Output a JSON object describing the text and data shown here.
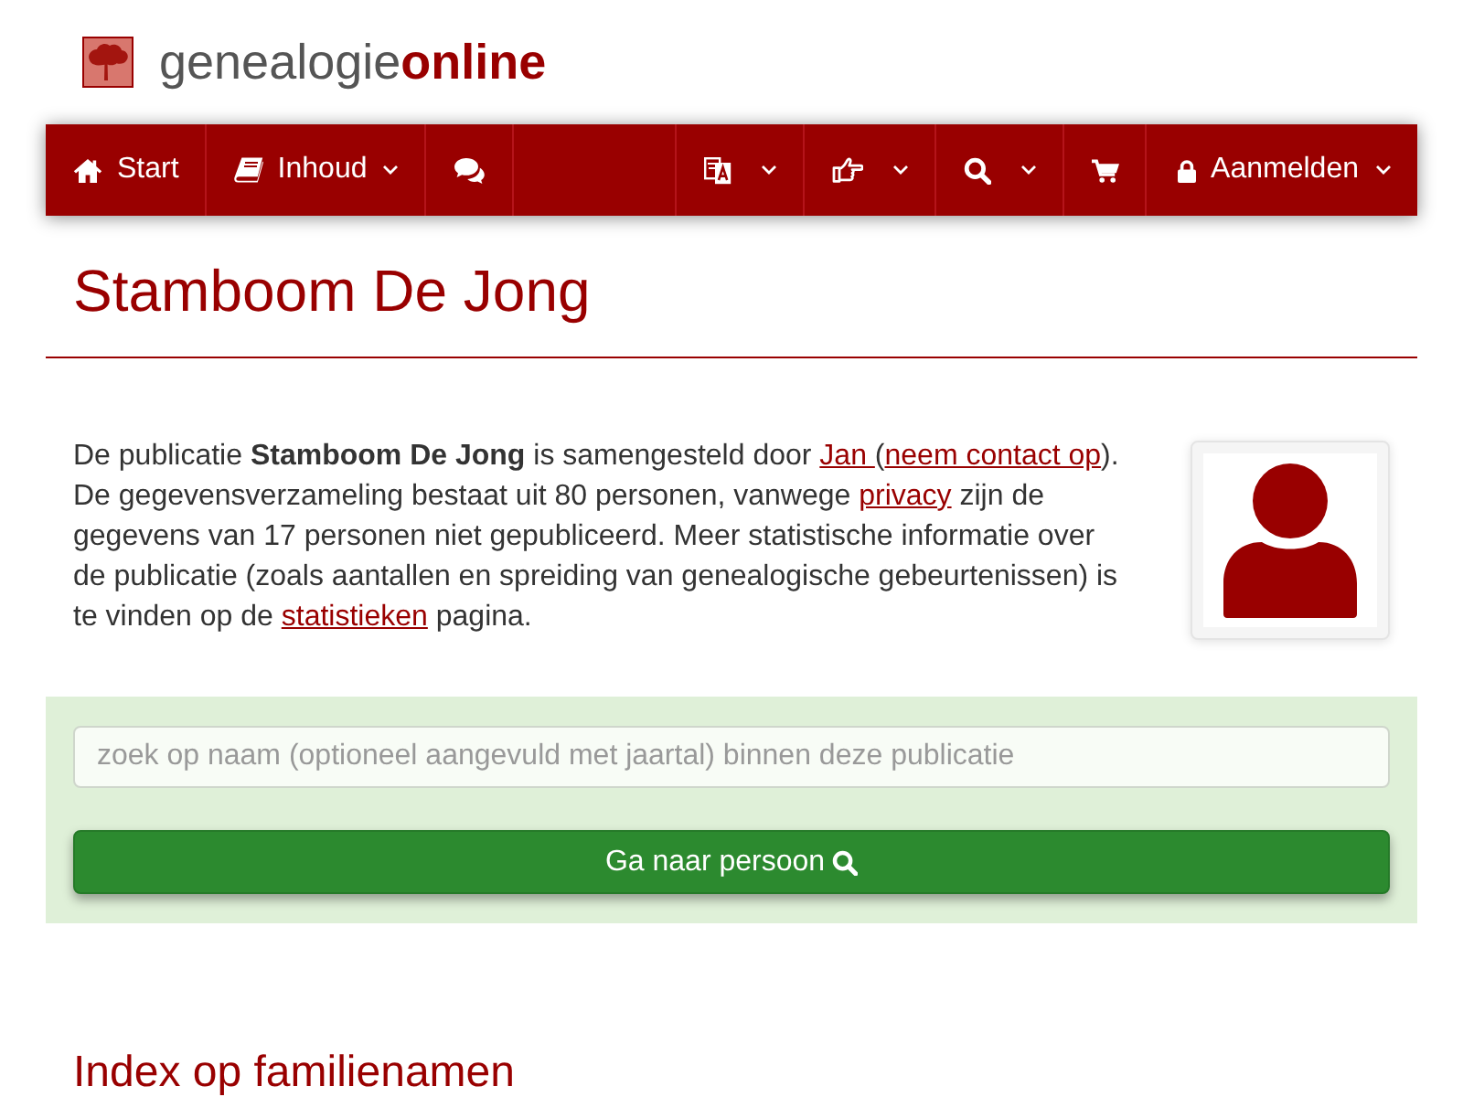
{
  "header": {
    "logo": "genealogie**online**"
  },
  "nav": {
    "left": [
      {
        "kind": "home",
        "label": "Start",
        "menu": false
      },
      {
        "kind": "contents",
        "label": "Inhoud",
        "menu": true
      },
      {
        "kind": "forum",
        "menu": false
      }
    ],
    "right": [
      {
        "kind": "language",
        "menu": true
      },
      {
        "kind": "recommend",
        "menu": true
      },
      {
        "kind": "search",
        "menu": true
      },
      {
        "kind": "cart",
        "menu": false
      },
      {
        "kind": "login",
        "label": "Aanmelden",
        "menu": true
      }
    ]
  },
  "title": "Stamboom De Jong",
  "description": [
    {
      "kind": "text",
      "text": "De publicatie **Stamboom De Jong** is samengesteld door "
    },
    {
      "kind": "link",
      "text": "Jan "
    },
    {
      "kind": "text",
      "text": "("
    },
    {
      "kind": "link",
      "text": "neem contact op"
    },
    {
      "kind": "text",
      "text": "). De gegevensverzameling bestaat uit 80 personen, vanwege "
    },
    {
      "kind": "link",
      "text": "privacy"
    },
    {
      "kind": "text",
      "text": " zijn de gegevens van 17 personen niet gepubliceerd. Meer statistische informatie over de publicatie (zoals aantallen en spreiding van genealogische gebeurtenissen) is te vinden op de "
    },
    {
      "kind": "link",
      "text": "statistieken"
    },
    {
      "kind": "text",
      "text": " pagina."
    }
  ],
  "search": {
    "placeholder": "zoek op naam (optioneel aangevuld met jaartal) binnen deze publicatie",
    "button": "Ga naar persoon"
  },
  "section_heading": "Index op familienamen"
}
